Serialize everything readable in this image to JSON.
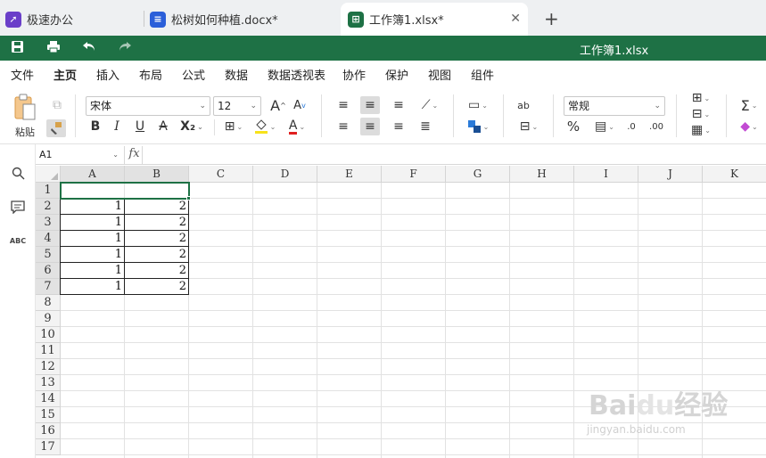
{
  "tabs": [
    {
      "label": "极速办公",
      "icon": "rocket-icon",
      "color": "#6a3fc9"
    },
    {
      "label": "松树如何种植.docx*",
      "icon": "doc-icon",
      "color": "#2b5fd9"
    },
    {
      "label": "工作簿1.xlsx*",
      "icon": "sheet-icon",
      "color": "#1e7145",
      "active": true
    }
  ],
  "titlebar": {
    "title": "工作簿1.xlsx",
    "color": "#1e7145"
  },
  "menu": {
    "items": [
      "文件",
      "主页",
      "插入",
      "布局",
      "公式",
      "数据",
      "数据透视表",
      "协作",
      "保护",
      "视图",
      "组件"
    ],
    "active": "主页"
  },
  "toolbar": {
    "paste_label": "粘贴",
    "font_name": "宋体",
    "font_size": "12",
    "number_format": "常规",
    "bold": "B",
    "italic": "I",
    "underline": "U",
    "strike": "A",
    "subscript": "X₂",
    "grow": "A",
    "shrink": "A",
    "fontcolor": "A",
    "percent": "%",
    "sum": "Σ"
  },
  "formula": {
    "cell_ref": "A1",
    "fx": "fx"
  },
  "grid": {
    "columns": [
      "A",
      "B",
      "C",
      "D",
      "E",
      "F",
      "G",
      "H",
      "I",
      "J",
      "K"
    ],
    "rows": [
      "1",
      "2",
      "3",
      "4",
      "5",
      "6",
      "7",
      "8",
      "9",
      "10",
      "11",
      "12",
      "13",
      "14",
      "15",
      "16",
      "17"
    ],
    "cells": [
      {
        "row": 2,
        "A": "1",
        "B": "2"
      },
      {
        "row": 3,
        "A": "1",
        "B": "2"
      },
      {
        "row": 4,
        "A": "1",
        "B": "2"
      },
      {
        "row": 5,
        "A": "1",
        "B": "2"
      },
      {
        "row": 6,
        "A": "1",
        "B": "2"
      },
      {
        "row": 7,
        "A": "1",
        "B": "2"
      }
    ],
    "selected_cell": "A1"
  },
  "watermark": {
    "logo": "Baidu经验",
    "url": "jingyan.baidu.com"
  }
}
